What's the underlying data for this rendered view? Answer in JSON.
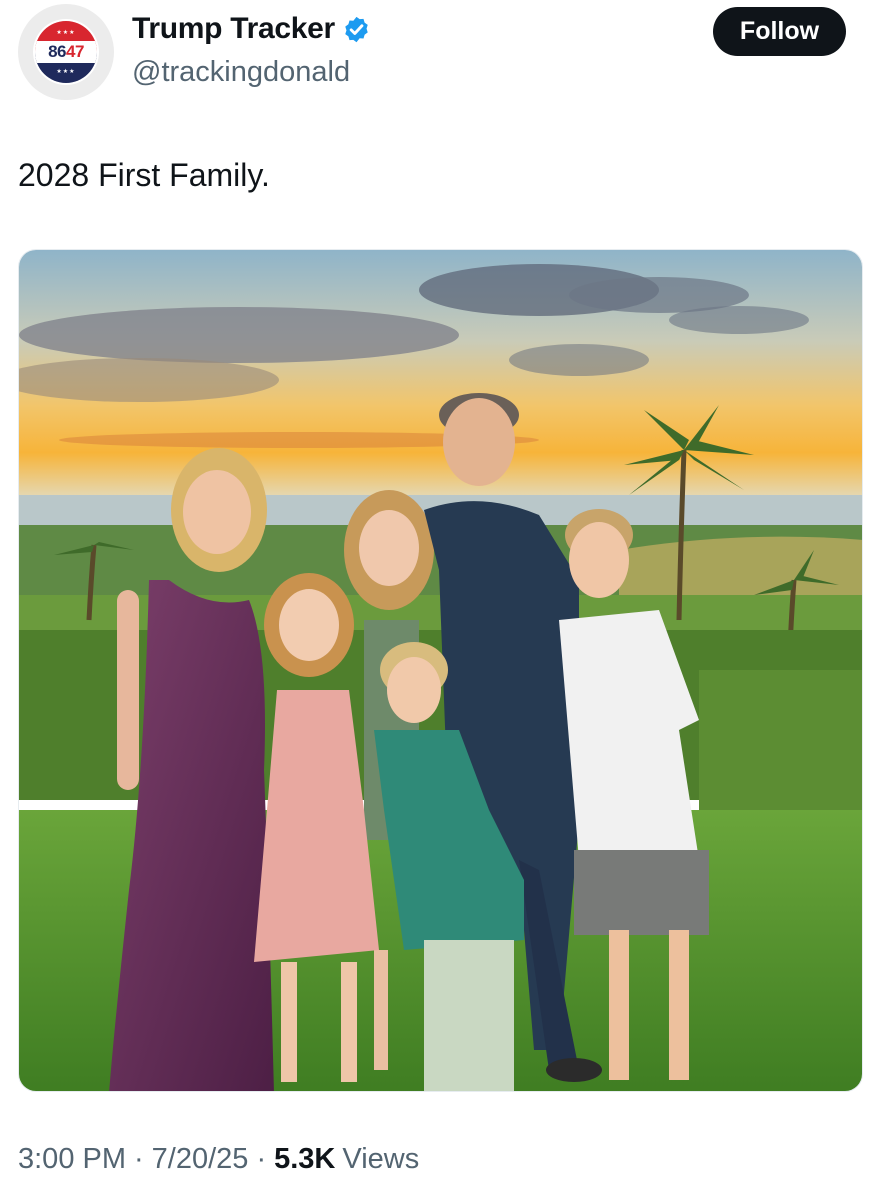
{
  "author": {
    "display_name": "Trump Tracker",
    "handle": "@trackingdonald",
    "verified": true,
    "avatar_text_left": "86",
    "avatar_text_right": "47",
    "avatar_stars": "★★★"
  },
  "follow_button": {
    "label": "Follow"
  },
  "tweet": {
    "text": "2028 First Family."
  },
  "meta": {
    "time": "3:00 PM",
    "separator": "·",
    "date": "7/20/25",
    "views_count": "5.3K",
    "views_label": "Views"
  },
  "icons": {
    "verified": "verified-badge-icon",
    "avatar": "8647-badge-logo"
  },
  "colors": {
    "verified_blue": "#1d9bf0",
    "text_primary": "#0f1419",
    "text_secondary": "#536471",
    "follow_bg": "#0f1419"
  }
}
